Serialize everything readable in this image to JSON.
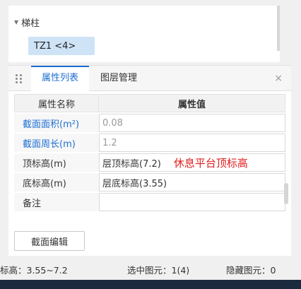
{
  "tree": {
    "group_label": "梯柱",
    "selected_item": "TZ1 <4>"
  },
  "panel": {
    "tabs": [
      "属性列表",
      "图层管理"
    ],
    "close_symbol": "×",
    "header": {
      "name_col": "属性名称",
      "value_col": "属性值"
    },
    "rows": [
      {
        "name": "截面面积(m²)",
        "value": "0.08",
        "name_color": "#1f6fd1",
        "readonly": true
      },
      {
        "name": "截面周长(m)",
        "value": "1.2",
        "name_color": "#1f6fd1",
        "readonly": true
      },
      {
        "name": "顶标高(m)",
        "value": "层顶标高(7.2)",
        "annotation": "休息平台顶标高",
        "annotation_color": "#e02020"
      },
      {
        "name": "底标高(m)",
        "value": "层底标高(3.55)"
      },
      {
        "name": "备注",
        "value": ""
      }
    ],
    "edit_button": "截面编辑"
  },
  "status": {
    "elevation": "标高：3.55~7.2",
    "selected": "选中图元：1(4)",
    "hidden": "隐藏图元：0"
  },
  "colors": {
    "accent": "#1f6fd1",
    "annotation": "#e02020",
    "selection_bg": "#cfe3f6"
  },
  "icons": [
    "collapse-arrow-icon",
    "drag-handle-icon",
    "close-icon"
  ]
}
